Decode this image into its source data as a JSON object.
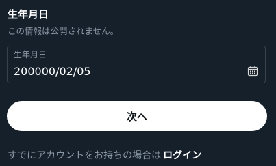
{
  "header": {
    "title": "生年月日",
    "subtitle": "この情報は公開されません。"
  },
  "birthdate_field": {
    "label": "生年月日",
    "value": "200000/02/05",
    "icon": "calendar-icon"
  },
  "next_button": {
    "label": "次へ"
  },
  "footer": {
    "prompt": "すでにアカウントをお持ちの場合は",
    "login_label": "ログイン"
  },
  "colors": {
    "background": "#15202b",
    "text_primary": "#ffffff",
    "text_secondary": "#8b98a5",
    "border": "#38444d",
    "button_background": "#ffffff",
    "button_text": "#0f1419"
  }
}
